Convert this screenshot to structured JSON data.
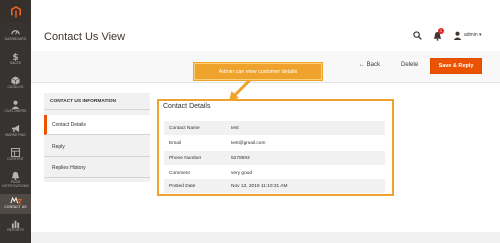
{
  "sidebar": {
    "items": [
      {
        "label": "DASHBOARD",
        "icon": "speedometer-icon"
      },
      {
        "label": "SALES",
        "icon": "dollar-icon"
      },
      {
        "label": "CATALOG",
        "icon": "box-icon"
      },
      {
        "label": "CUSTOMERS",
        "icon": "person-icon"
      },
      {
        "label": "MARKETING",
        "icon": "megaphone-icon"
      },
      {
        "label": "CONTENT",
        "icon": "layout-icon"
      },
      {
        "label": "PUSH\nNOTIFICATIONS",
        "icon": "push-notification-icon"
      },
      {
        "label": "CONTACT US",
        "icon": "contact-us-logo-icon"
      },
      {
        "label": "REPORTS",
        "icon": "bar-chart-icon"
      }
    ],
    "active_index": 7
  },
  "header": {
    "title": "Contact Us View",
    "notification_count": "1",
    "username": "admin"
  },
  "actions": {
    "back_label": "← Back",
    "delete_label": "Delete",
    "save_reply_label": "Save & Reply"
  },
  "callout": {
    "text": "Admin can view customer details"
  },
  "tabs": {
    "title": "CONTACT US INFORMATION",
    "items": [
      "Contact Details",
      "Reply",
      "Replies History"
    ],
    "active_index": 0
  },
  "details": {
    "title": "Contact Details",
    "rows": [
      {
        "label": "Contact Name",
        "value": "test"
      },
      {
        "label": "Email",
        "value": "test@gmail.com"
      },
      {
        "label": "Phone Number",
        "value": "5278693"
      },
      {
        "label": "Comment",
        "value": "very good"
      },
      {
        "label": "Posted Date",
        "value": "Nov 13, 2019 11:10:31 AM"
      }
    ]
  },
  "colors": {
    "sidebar_bg": "#373330",
    "accent_orange": "#eb5202",
    "highlight": "#f0a32c",
    "active_nav": "#514943",
    "magento_logo": "#f26322"
  }
}
